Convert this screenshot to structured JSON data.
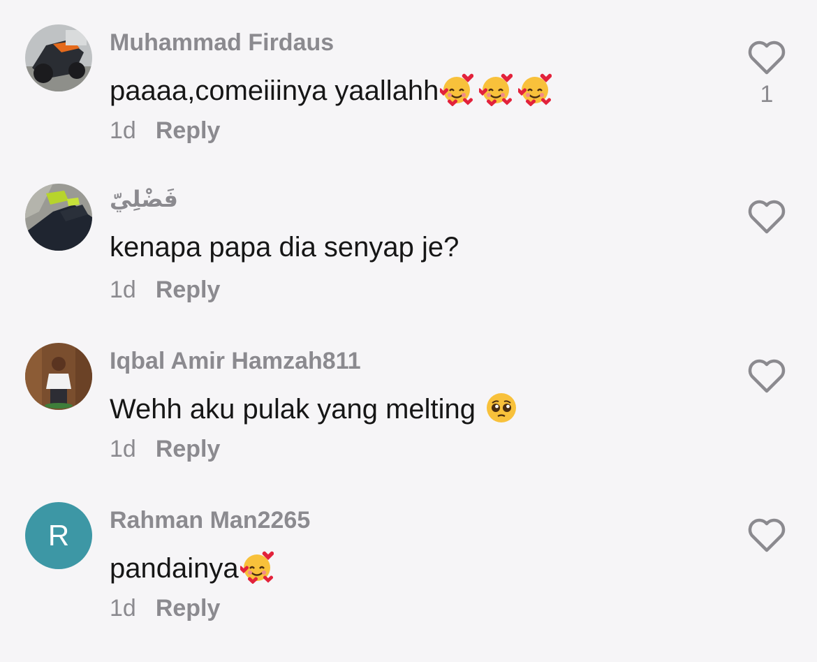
{
  "comments": [
    {
      "username": "Muhammad Firdaus",
      "text": "paaaa,comeiiinya yaallahh",
      "emojis": [
        "smiling-face-with-hearts",
        "smiling-face-with-hearts",
        "smiling-face-with-hearts"
      ],
      "time": "1d",
      "reply_label": "Reply",
      "like_count": "1"
    },
    {
      "username": "فَضْلِيّ",
      "text": "kenapa papa dia senyap je?",
      "emojis": [],
      "time": "1d",
      "reply_label": "Reply",
      "like_count": ""
    },
    {
      "username": "Iqbal Amir Hamzah811",
      "text": "Wehh aku pulak yang melting ",
      "emojis": [
        "pleading-face"
      ],
      "time": "1d",
      "reply_label": "Reply",
      "like_count": ""
    },
    {
      "username": "Rahman Man2265",
      "avatar_letter": "R",
      "text": "pandainya",
      "emojis": [
        "smiling-face-with-hearts"
      ],
      "time": "1d",
      "reply_label": "Reply",
      "like_count": ""
    }
  ],
  "icons": {
    "like": "heart-outline-icon"
  },
  "colors": {
    "background": "#f6f5f7",
    "username": "#8b8a8f",
    "comment_text": "#161616",
    "avatar_letter_bg": "#3d97a5"
  }
}
